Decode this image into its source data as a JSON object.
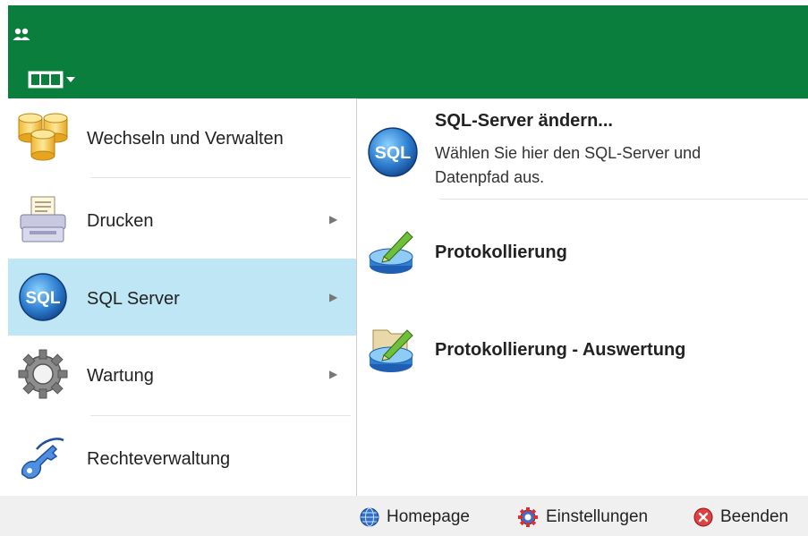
{
  "header": {
    "app_icon": "users-icon",
    "view_button_icon": "view-columns-icon"
  },
  "menu": {
    "items": [
      {
        "label": "Wechseln und Verwalten",
        "icon": "database-stack-icon",
        "has_submenu": false
      },
      {
        "label": "Drucken",
        "icon": "printer-icon",
        "has_submenu": true
      },
      {
        "label": "SQL Server",
        "icon": "sql-icon",
        "has_submenu": true,
        "active": true
      },
      {
        "label": "Wartung",
        "icon": "gear-icon",
        "has_submenu": true
      },
      {
        "label": "Rechteverwaltung",
        "icon": "key-icon",
        "has_submenu": false
      }
    ]
  },
  "submenu": {
    "items": [
      {
        "title": "SQL-Server ändern...",
        "description": "Wählen Sie hier den SQL-Server und Datenpfad aus.",
        "icon": "sql-icon"
      },
      {
        "title": "Protokollierung",
        "icon": "database-pencil-icon"
      },
      {
        "title": "Protokollierung - Auswertung",
        "icon": "database-folder-pencil-icon"
      }
    ]
  },
  "footer": {
    "homepage_label": "Homepage",
    "settings_label": "Einstellungen",
    "exit_label": "Beenden"
  },
  "colors": {
    "header_green": "#0a7e3c",
    "active_item": "#bfe6f4",
    "footer_bg": "#f0f0f0"
  }
}
